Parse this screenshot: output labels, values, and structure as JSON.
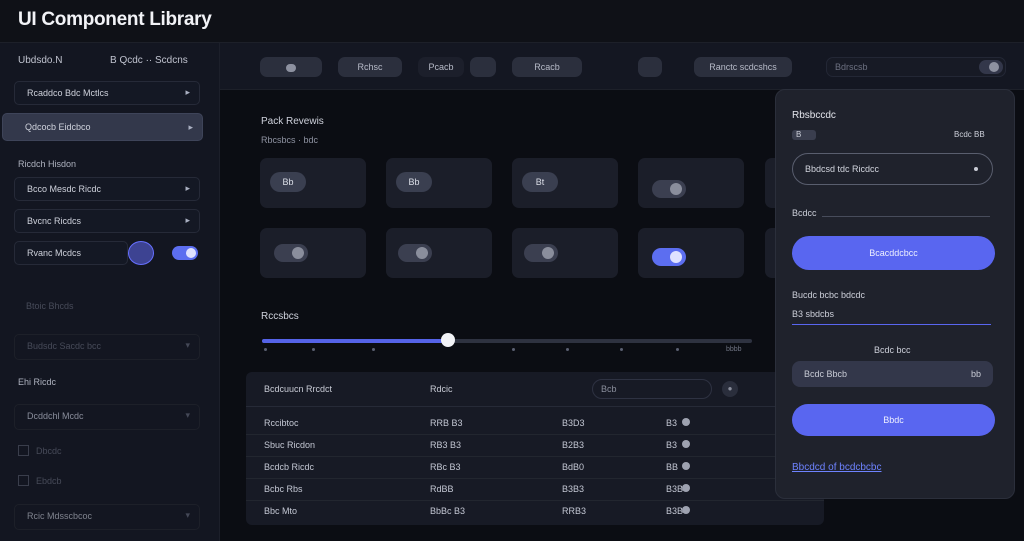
{
  "app": {
    "title": "UI Component Library"
  },
  "sidebar": {
    "header_left": "Ubdsdo.N",
    "header_right": "B Qcdc ·· Scdcns",
    "items": [
      {
        "label": "Rcaddco Bdc Mctlcs",
        "state": "normal"
      },
      {
        "label": "Qdcocb Eidcbco",
        "state": "active"
      }
    ],
    "section1_label": "Ricdch Hisdon",
    "section1_items": [
      {
        "label": "Bcco Mesdc Ricdc"
      },
      {
        "label": "Bvcnc Ricdcs"
      }
    ],
    "toggle_row": {
      "label": "Rvanc Mcdcs"
    },
    "faded_items": [
      {
        "label": "Btoic Bhcds"
      },
      {
        "label": "Budsdc Sacdc bcc"
      }
    ],
    "section2_label": "Ehi Ricdc",
    "section2_items": [
      {
        "label": "Dcddchl Mcdc"
      }
    ],
    "checkbox_labels": [
      "Dbcdc",
      "Ebdcb"
    ],
    "last_item": {
      "label": "Rcic Mdsscbcoc"
    }
  },
  "toolbar": {
    "pills": [
      "",
      "Rchsc",
      "Pcacb",
      "",
      "Rcacb",
      "",
      "Ranctc scdcshcs"
    ],
    "search_placeholder": "Bdrscsb"
  },
  "main": {
    "section_title": "Pack Revewis",
    "section_subtitle": "Rbcsbcs · bdc",
    "cards_row1": [
      "Bb",
      "Bb",
      "Bt"
    ],
    "cards_row2": [
      "",
      "",
      ""
    ],
    "slider_label": "Rccsbcs",
    "slider_value": 0.38,
    "slider_end_label": "bbbb"
  },
  "table": {
    "headers": {
      "col1": "Bcdcuucn Rrcdct",
      "col2": "Rdcic",
      "search": "Bcb"
    },
    "rows": [
      {
        "c1": "Rccibtoc",
        "c2": "RRB B3",
        "c3": "B3D3",
        "c4": "B3"
      },
      {
        "c1": "Sbuc Ricdon",
        "c2": "RB3 B3",
        "c3": "B2B3",
        "c4": "B3"
      },
      {
        "c1": "Bcdcb Ricdc",
        "c2": "RBc B3",
        "c3": "BdB0",
        "c4": "BB"
      },
      {
        "c1": "Bcbc Rbs",
        "c2": "RdBB",
        "c3": "B3B3",
        "c4": "B3B"
      },
      {
        "c1": "Bbc Mto",
        "c2": "BbBc B3",
        "c3": "RRB3",
        "c4": "B3B"
      }
    ]
  },
  "panel": {
    "title": "Rbsbccdc",
    "row_left": "B",
    "row_right": "Bcdc BB",
    "select_value": "Bbdcsd tdc Ricdcc",
    "field1_label": "Bcdcc",
    "button1": "Bcacddcbcc",
    "field2_label": "Bucdc bcbc bdcdc",
    "field2_value": "B3 sbdcbs",
    "center_label": "Bcdc bcc",
    "dropdown_value": "Bcdc Bbcb",
    "dropdown_right": "bb",
    "button2": "Bbdc",
    "link": "Bbcdcd of bcdcbcbc"
  }
}
